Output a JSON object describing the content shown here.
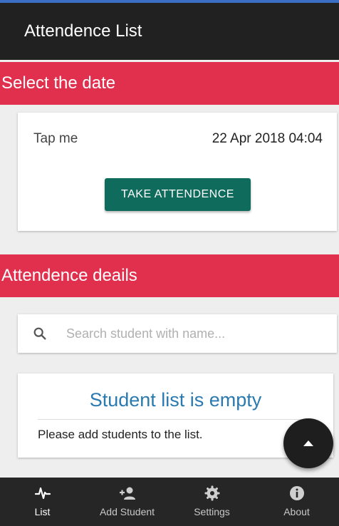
{
  "app_bar": {
    "title": "Attendence List"
  },
  "date_section": {
    "header": "Select the date",
    "tap_label": "Tap me",
    "date_value": "22 Apr 2018 04:04",
    "take_button": "TAKE ATTENDENCE"
  },
  "details_section": {
    "header": "Attendence deails",
    "search": {
      "placeholder": "Search student with name...",
      "value": ""
    },
    "empty": {
      "title": "Student list is empty",
      "message": "Please add students to the list."
    }
  },
  "fab": {
    "icon": "arrow-up-icon"
  },
  "bottom_nav": {
    "items": [
      {
        "label": "List",
        "icon": "pulse-icon",
        "active": true
      },
      {
        "label": "Add Student",
        "icon": "add-person-icon",
        "active": false
      },
      {
        "label": "Settings",
        "icon": "gear-icon",
        "active": false
      },
      {
        "label": "About",
        "icon": "info-icon",
        "active": false
      }
    ]
  },
  "colors": {
    "app_bar": "#212121",
    "section_header": "#e0304e",
    "primary_button": "#0f6b5c",
    "empty_title": "#2a7ab0",
    "bottom_nav": "#262626"
  }
}
